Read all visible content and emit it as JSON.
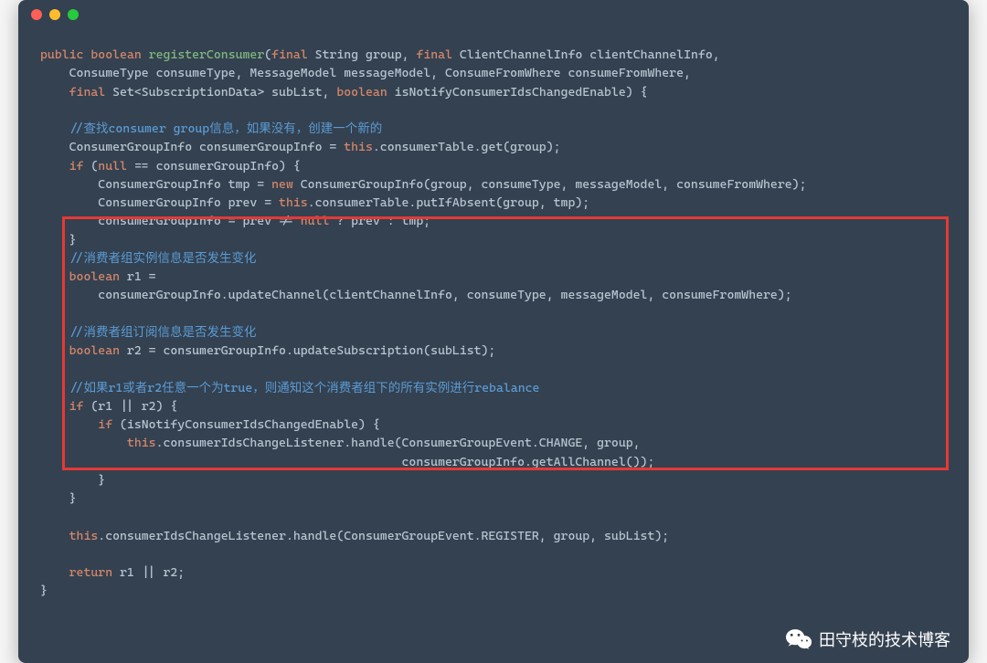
{
  "titlebar": {
    "buttons": [
      "close",
      "minimize",
      "maximize"
    ]
  },
  "code": {
    "line1": {
      "public": "public",
      "boolean": "boolean",
      "method": "registerConsumer",
      "final1": "final",
      "string": "String",
      "group": "group,",
      "final2": "final",
      "cci": "ClientChannelInfo clientChannelInfo,"
    },
    "line2": {
      "ct": "ConsumeType consumeType, MessageModel messageModel, ConsumeFromWhere consumeFromWhere,"
    },
    "line3": {
      "final": "final",
      "set": "Set<SubscriptionData> subList,",
      "boolean": "boolean",
      "param": "isNotifyConsumerIdsChangedEnable) {"
    },
    "line5": {
      "comment": "//查找consumer group信息，如果没有，创建一个新的"
    },
    "line6": {
      "text1": "ConsumerGroupInfo consumerGroupInfo = ",
      "this": "this",
      "text2": ".consumerTable.get(group);"
    },
    "line7": {
      "if": "if",
      "text1": " (",
      "null": "null",
      "text2": " == consumerGroupInfo) {"
    },
    "line8": {
      "text1": "ConsumerGroupInfo tmp = ",
      "new": "new",
      "text2": " ConsumerGroupInfo(group, consumeType, messageModel, consumeFromWhere);"
    },
    "line9": {
      "text1": "ConsumerGroupInfo prev = ",
      "this": "this",
      "text2": ".consumerTable.putIfAbsent(group, tmp);"
    },
    "line10": {
      "text1": "consumerGroupInfo = prev != ",
      "null": "null",
      "text2": " ? prev : tmp;"
    },
    "line11": {
      "brace": "}"
    },
    "line12": {
      "comment": "//消费者组实例信息是否发生变化"
    },
    "line13": {
      "boolean": "boolean",
      "text": " r1 ="
    },
    "line14": {
      "text": "consumerGroupInfo.updateChannel(clientChannelInfo, consumeType, messageModel, consumeFromWhere);"
    },
    "line16": {
      "comment": "//消费者组订阅信息是否发生变化"
    },
    "line17": {
      "boolean": "boolean",
      "text": " r2 = consumerGroupInfo.updateSubscription(subList);"
    },
    "line19": {
      "comment": "//如果r1或者r2任意一个为true，则通知这个消费者组下的所有实例进行rebalance"
    },
    "line20": {
      "if": "if",
      "text": " (r1 || r2) {"
    },
    "line21": {
      "if": "if",
      "text": " (isNotifyConsumerIdsChangedEnable) {"
    },
    "line22": {
      "this": "this",
      "text": ".consumerIdsChangeListener.handle(ConsumerGroupEvent.CHANGE, group,"
    },
    "line23": {
      "text": "consumerGroupInfo.getAllChannel());"
    },
    "line24": {
      "brace": "}"
    },
    "line25": {
      "brace": "}"
    },
    "line27": {
      "this": "this",
      "text": ".consumerIdsChangeListener.handle(ConsumerGroupEvent.REGISTER, group, subList);"
    },
    "line29": {
      "return": "return",
      "text": " r1 || r2;"
    },
    "line30": {
      "brace": "}"
    }
  },
  "watermark": {
    "text": "田守枝的技术博客"
  }
}
